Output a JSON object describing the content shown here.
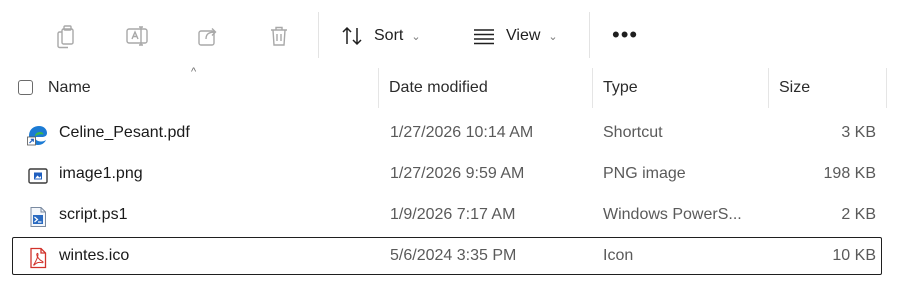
{
  "toolbar": {
    "sort_label": "Sort",
    "view_label": "View",
    "more_label": "•••",
    "chevron": "⌄",
    "icons": [
      "copy-icon",
      "rename-icon",
      "share-icon",
      "delete-icon",
      "sort-icon",
      "view-icon"
    ]
  },
  "header": {
    "sort_caret": "^",
    "columns": {
      "name": "Name",
      "date": "Date modified",
      "type": "Type",
      "size": "Size"
    }
  },
  "files": [
    {
      "icon": "shortcut-edge-icon",
      "name": "Celine_Pesant.pdf",
      "date": "1/27/2026 10:14 AM",
      "type": "Shortcut",
      "size": "3 KB",
      "focused": false
    },
    {
      "icon": "png-image-icon",
      "name": "image1.png",
      "date": "1/27/2026 9:59 AM",
      "type": "PNG image",
      "size": "198 KB",
      "focused": false
    },
    {
      "icon": "powershell-script-icon",
      "name": "script.ps1",
      "date": "1/9/2026 7:17 AM",
      "type": "Windows PowerS...",
      "size": "2 KB",
      "focused": false
    },
    {
      "icon": "pdf-ico-icon",
      "name": "wintes.ico",
      "date": "5/6/2024 3:35 PM",
      "type": "Icon",
      "size": "10 KB",
      "focused": true
    }
  ],
  "colors": {
    "disabled_icon": "#a8a8a8",
    "focus_border": "#1f1f1f",
    "edge_blue": "#1c7bd4",
    "edge_green": "#3fb84a",
    "pdf_red": "#d1322b"
  }
}
